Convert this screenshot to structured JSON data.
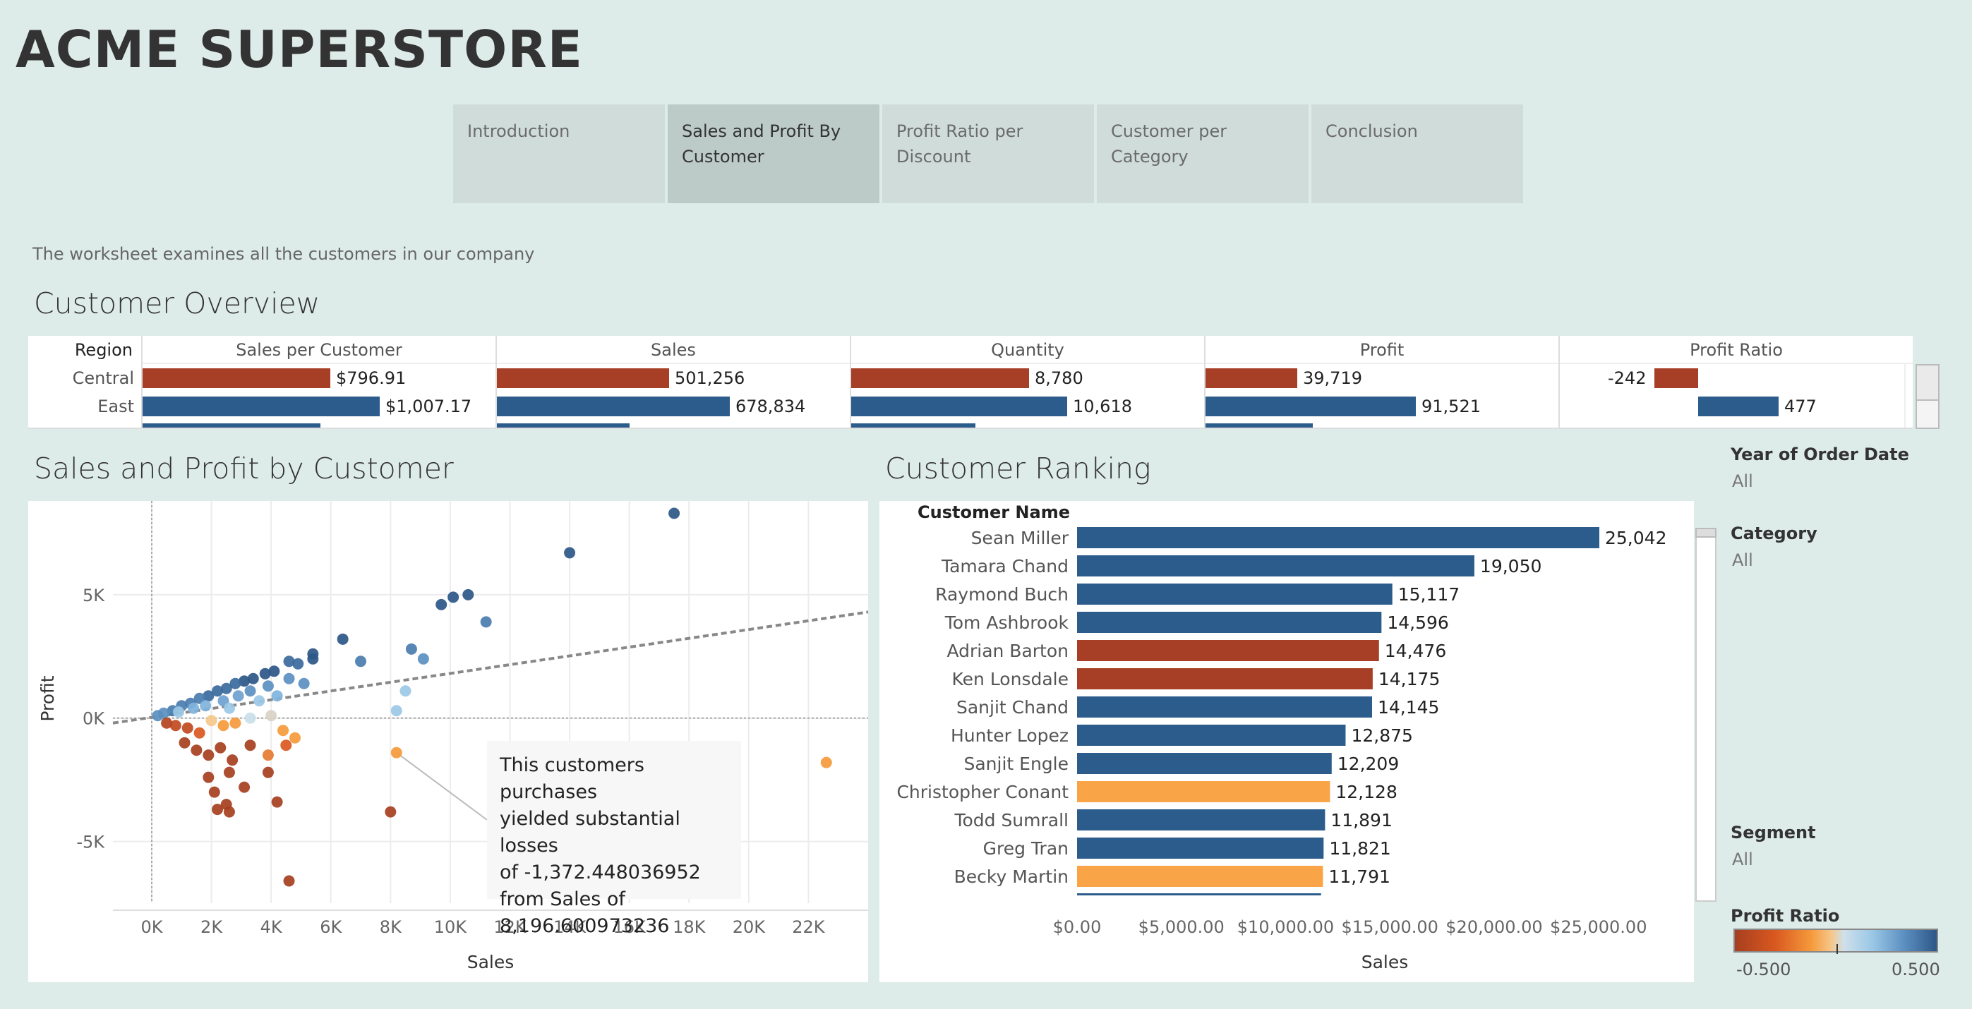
{
  "app": {
    "title": "ACME SUPERSTORE"
  },
  "tabs": [
    {
      "label": "Introduction",
      "active": false
    },
    {
      "label": "Sales and Profit By Customer",
      "active": true
    },
    {
      "label": "Profit Ratio per Discount",
      "active": false
    },
    {
      "label": "Customer per Category",
      "active": false
    },
    {
      "label": "Conclusion",
      "active": false
    }
  ],
  "intro_text": "The worksheet examines all the customers in our company",
  "overview": {
    "title": "Customer Overview",
    "region_header": "Region",
    "columns": [
      "Sales per Customer",
      "Sales",
      "Quantity",
      "Profit",
      "Profit Ratio"
    ],
    "rows": [
      {
        "region": "Central",
        "sales_per_customer": "$796.91",
        "sales": "501,256",
        "quantity": "8,780",
        "profit": "39,719",
        "profit_ratio": "-242",
        "color": "#a63f25"
      },
      {
        "region": "East",
        "sales_per_customer": "$1,007.17",
        "sales": "678,834",
        "quantity": "10,618",
        "profit": "91,521",
        "profit_ratio": "477",
        "color": "#2c5c8c"
      }
    ]
  },
  "scatter": {
    "title": "Sales and Profit by Customer",
    "tooltip": [
      "This customers purchases",
      "yielded substantial losses",
      "of  -1,372.448036952",
      "from Sales of",
      "8,196.600973236"
    ]
  },
  "ranking": {
    "title": "Customer Ranking",
    "header": "Customer Name"
  },
  "filters": [
    {
      "label": "Year of Order Date",
      "value": "All"
    },
    {
      "label": "Category",
      "value": "All"
    },
    {
      "label": "Segment",
      "value": "All"
    }
  ],
  "legend": {
    "title": "Profit Ratio",
    "min": "-0.500",
    "max": "0.500"
  },
  "chart_data": [
    {
      "type": "scatter",
      "title": "Sales and Profit by Customer",
      "xlabel": "Sales",
      "ylabel": "Profit",
      "x_ticks": [
        "0K",
        "2K",
        "4K",
        "6K",
        "8K",
        "10K",
        "12K",
        "14K",
        "16K",
        "18K",
        "20K",
        "22K"
      ],
      "y_ticks": [
        "5K",
        "0K",
        "-5K"
      ],
      "xlim": [
        -1300,
        24000
      ],
      "ylim": [
        -7500,
        8800
      ],
      "trend_line": {
        "x": [
          -1300,
          24000
        ],
        "y": [
          -200,
          4300
        ]
      },
      "points": [
        {
          "x": 17500,
          "y": 8300,
          "c": "#2c5788"
        },
        {
          "x": 14000,
          "y": 6700,
          "c": "#2c5788"
        },
        {
          "x": 10600,
          "y": 5000,
          "c": "#2c5788"
        },
        {
          "x": 10100,
          "y": 4900,
          "c": "#2c5788"
        },
        {
          "x": 9700,
          "y": 4600,
          "c": "#2c5788"
        },
        {
          "x": 11200,
          "y": 3900,
          "c": "#4a7db0"
        },
        {
          "x": 6400,
          "y": 3200,
          "c": "#2c5788"
        },
        {
          "x": 8700,
          "y": 2800,
          "c": "#4a7db0"
        },
        {
          "x": 9100,
          "y": 2400,
          "c": "#5b8fc0"
        },
        {
          "x": 5400,
          "y": 2600,
          "c": "#2c5788"
        },
        {
          "x": 5400,
          "y": 2400,
          "c": "#2c5788"
        },
        {
          "x": 7000,
          "y": 2300,
          "c": "#4a7db0"
        },
        {
          "x": 4900,
          "y": 2200,
          "c": "#3a6a9c"
        },
        {
          "x": 4600,
          "y": 2300,
          "c": "#3a6a9c"
        },
        {
          "x": 4100,
          "y": 1900,
          "c": "#2c5788"
        },
        {
          "x": 3800,
          "y": 1800,
          "c": "#2c5788"
        },
        {
          "x": 3400,
          "y": 1600,
          "c": "#2c5788"
        },
        {
          "x": 3100,
          "y": 1500,
          "c": "#2c5788"
        },
        {
          "x": 2800,
          "y": 1400,
          "c": "#3a6a9c"
        },
        {
          "x": 2500,
          "y": 1200,
          "c": "#3a6a9c"
        },
        {
          "x": 2200,
          "y": 1100,
          "c": "#3a6a9c"
        },
        {
          "x": 1900,
          "y": 900,
          "c": "#3a6a9c"
        },
        {
          "x": 1600,
          "y": 800,
          "c": "#4a7db0"
        },
        {
          "x": 1300,
          "y": 600,
          "c": "#4a7db0"
        },
        {
          "x": 1000,
          "y": 500,
          "c": "#4a7db0"
        },
        {
          "x": 700,
          "y": 300,
          "c": "#4a7db0"
        },
        {
          "x": 400,
          "y": 200,
          "c": "#5b8fc0"
        },
        {
          "x": 200,
          "y": 100,
          "c": "#5b8fc0"
        },
        {
          "x": 4600,
          "y": 1600,
          "c": "#5b8fc0"
        },
        {
          "x": 5100,
          "y": 1400,
          "c": "#5b8fc0"
        },
        {
          "x": 3900,
          "y": 1300,
          "c": "#5b8fc0"
        },
        {
          "x": 3300,
          "y": 1100,
          "c": "#5b8fc0"
        },
        {
          "x": 2900,
          "y": 900,
          "c": "#6ea1cf"
        },
        {
          "x": 2400,
          "y": 700,
          "c": "#6ea1cf"
        },
        {
          "x": 1800,
          "y": 500,
          "c": "#7fb3dc"
        },
        {
          "x": 1400,
          "y": 400,
          "c": "#7fb3dc"
        },
        {
          "x": 900,
          "y": 250,
          "c": "#9ac8e6"
        },
        {
          "x": 4200,
          "y": 900,
          "c": "#7fb3dc"
        },
        {
          "x": 3600,
          "y": 700,
          "c": "#9ac8e6"
        },
        {
          "x": 2600,
          "y": 400,
          "c": "#9ac8e6"
        },
        {
          "x": 8500,
          "y": 1100,
          "c": "#9ac8e6"
        },
        {
          "x": 8200,
          "y": 300,
          "c": "#9ac8e6"
        },
        {
          "x": 4000,
          "y": 100,
          "c": "#d8d2c4"
        },
        {
          "x": 3300,
          "y": 0,
          "c": "#c9dfe9"
        },
        {
          "x": 2000,
          "y": -100,
          "c": "#f5c88c"
        },
        {
          "x": 2400,
          "y": -300,
          "c": "#f59a3c"
        },
        {
          "x": 2800,
          "y": -200,
          "c": "#f59a3c"
        },
        {
          "x": 4400,
          "y": -500,
          "c": "#f59a3c"
        },
        {
          "x": 4800,
          "y": -800,
          "c": "#f59a3c"
        },
        {
          "x": 3900,
          "y": -1500,
          "c": "#e47a30"
        },
        {
          "x": 4500,
          "y": -1100,
          "c": "#d9581f"
        },
        {
          "x": 8200,
          "y": -1400,
          "c": "#f59a3c"
        },
        {
          "x": 22600,
          "y": -1800,
          "c": "#f59a3c"
        },
        {
          "x": 1600,
          "y": -600,
          "c": "#d9581f"
        },
        {
          "x": 1200,
          "y": -400,
          "c": "#c04a1f"
        },
        {
          "x": 800,
          "y": -300,
          "c": "#c04a1f"
        },
        {
          "x": 500,
          "y": -200,
          "c": "#b3441f"
        },
        {
          "x": 1100,
          "y": -1000,
          "c": "#a63f1f"
        },
        {
          "x": 1500,
          "y": -1300,
          "c": "#a63f1f"
        },
        {
          "x": 1900,
          "y": -1500,
          "c": "#a63f1f"
        },
        {
          "x": 2300,
          "y": -1200,
          "c": "#a63f1f"
        },
        {
          "x": 2700,
          "y": -1700,
          "c": "#a63f1f"
        },
        {
          "x": 3300,
          "y": -1100,
          "c": "#a63f1f"
        },
        {
          "x": 2600,
          "y": -2200,
          "c": "#a63f1f"
        },
        {
          "x": 3100,
          "y": -2800,
          "c": "#a63f1f"
        },
        {
          "x": 1900,
          "y": -2400,
          "c": "#a63f1f"
        },
        {
          "x": 2100,
          "y": -3000,
          "c": "#a63f1f"
        },
        {
          "x": 2500,
          "y": -3500,
          "c": "#a63f1f"
        },
        {
          "x": 2200,
          "y": -3700,
          "c": "#a63f1f"
        },
        {
          "x": 2600,
          "y": -3800,
          "c": "#a63f1f"
        },
        {
          "x": 4200,
          "y": -3400,
          "c": "#a63f1f"
        },
        {
          "x": 3900,
          "y": -2200,
          "c": "#a63f1f"
        },
        {
          "x": 8000,
          "y": -3800,
          "c": "#a63f1f"
        },
        {
          "x": 4600,
          "y": -6600,
          "c": "#a63f1f"
        }
      ]
    },
    {
      "type": "bar",
      "title": "Customer Ranking",
      "xlabel": "Sales",
      "ylabel": "Customer Name",
      "x_ticks": [
        "$0.00",
        "$5,000.00",
        "$10,000.00",
        "$15,000.00",
        "$20,000.00",
        "$25,000.00"
      ],
      "xlim": [
        0,
        28500
      ],
      "categories": [
        "Sean Miller",
        "Tamara Chand",
        "Raymond Buch",
        "Tom Ashbrook",
        "Adrian Barton",
        "Ken Lonsdale",
        "Sanjit Chand",
        "Hunter Lopez",
        "Sanjit Engle",
        "Christopher Conant",
        "Todd Sumrall",
        "Greg Tran",
        "Becky Martin"
      ],
      "values": [
        25042,
        19050,
        15117,
        14596,
        14476,
        14175,
        14145,
        12875,
        12209,
        12128,
        11891,
        11821,
        11791
      ],
      "labels": [
        "25,042",
        "19,050",
        "15,117",
        "14,596",
        "14,476",
        "14,175",
        "14,145",
        "12,875",
        "12,209",
        "12,128",
        "11,891",
        "11,821",
        "11,791"
      ],
      "colors": [
        "#2c5c8c",
        "#2c5c8c",
        "#2c5c8c",
        "#2c5c8c",
        "#a63f25",
        "#a63f25",
        "#2c5c8c",
        "#2c5c8c",
        "#2c5c8c",
        "#f9a447",
        "#2c5c8c",
        "#2c5c8c",
        "#f9a447"
      ]
    }
  ]
}
